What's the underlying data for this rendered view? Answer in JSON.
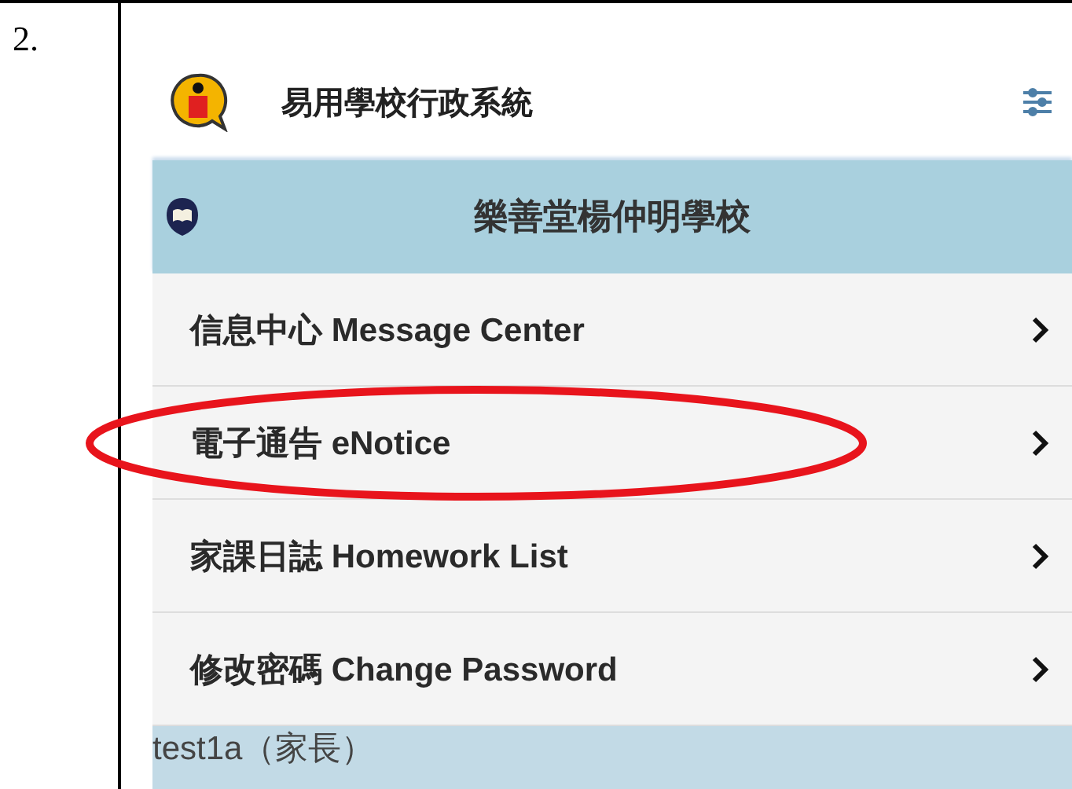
{
  "step_number": "2.",
  "app_header": {
    "title": "易用學校行政系統"
  },
  "school_bar": {
    "name": "樂善堂楊仲明學校"
  },
  "menu_items": [
    {
      "label": "信息中心 Message Center",
      "circled": false
    },
    {
      "label": "電子通告 eNotice",
      "circled": true
    },
    {
      "label": "家課日誌 Homework List",
      "circled": false
    },
    {
      "label": "修改密碼 Change Password",
      "circled": false
    }
  ],
  "user_bar": {
    "user": "test1a（家長）"
  }
}
